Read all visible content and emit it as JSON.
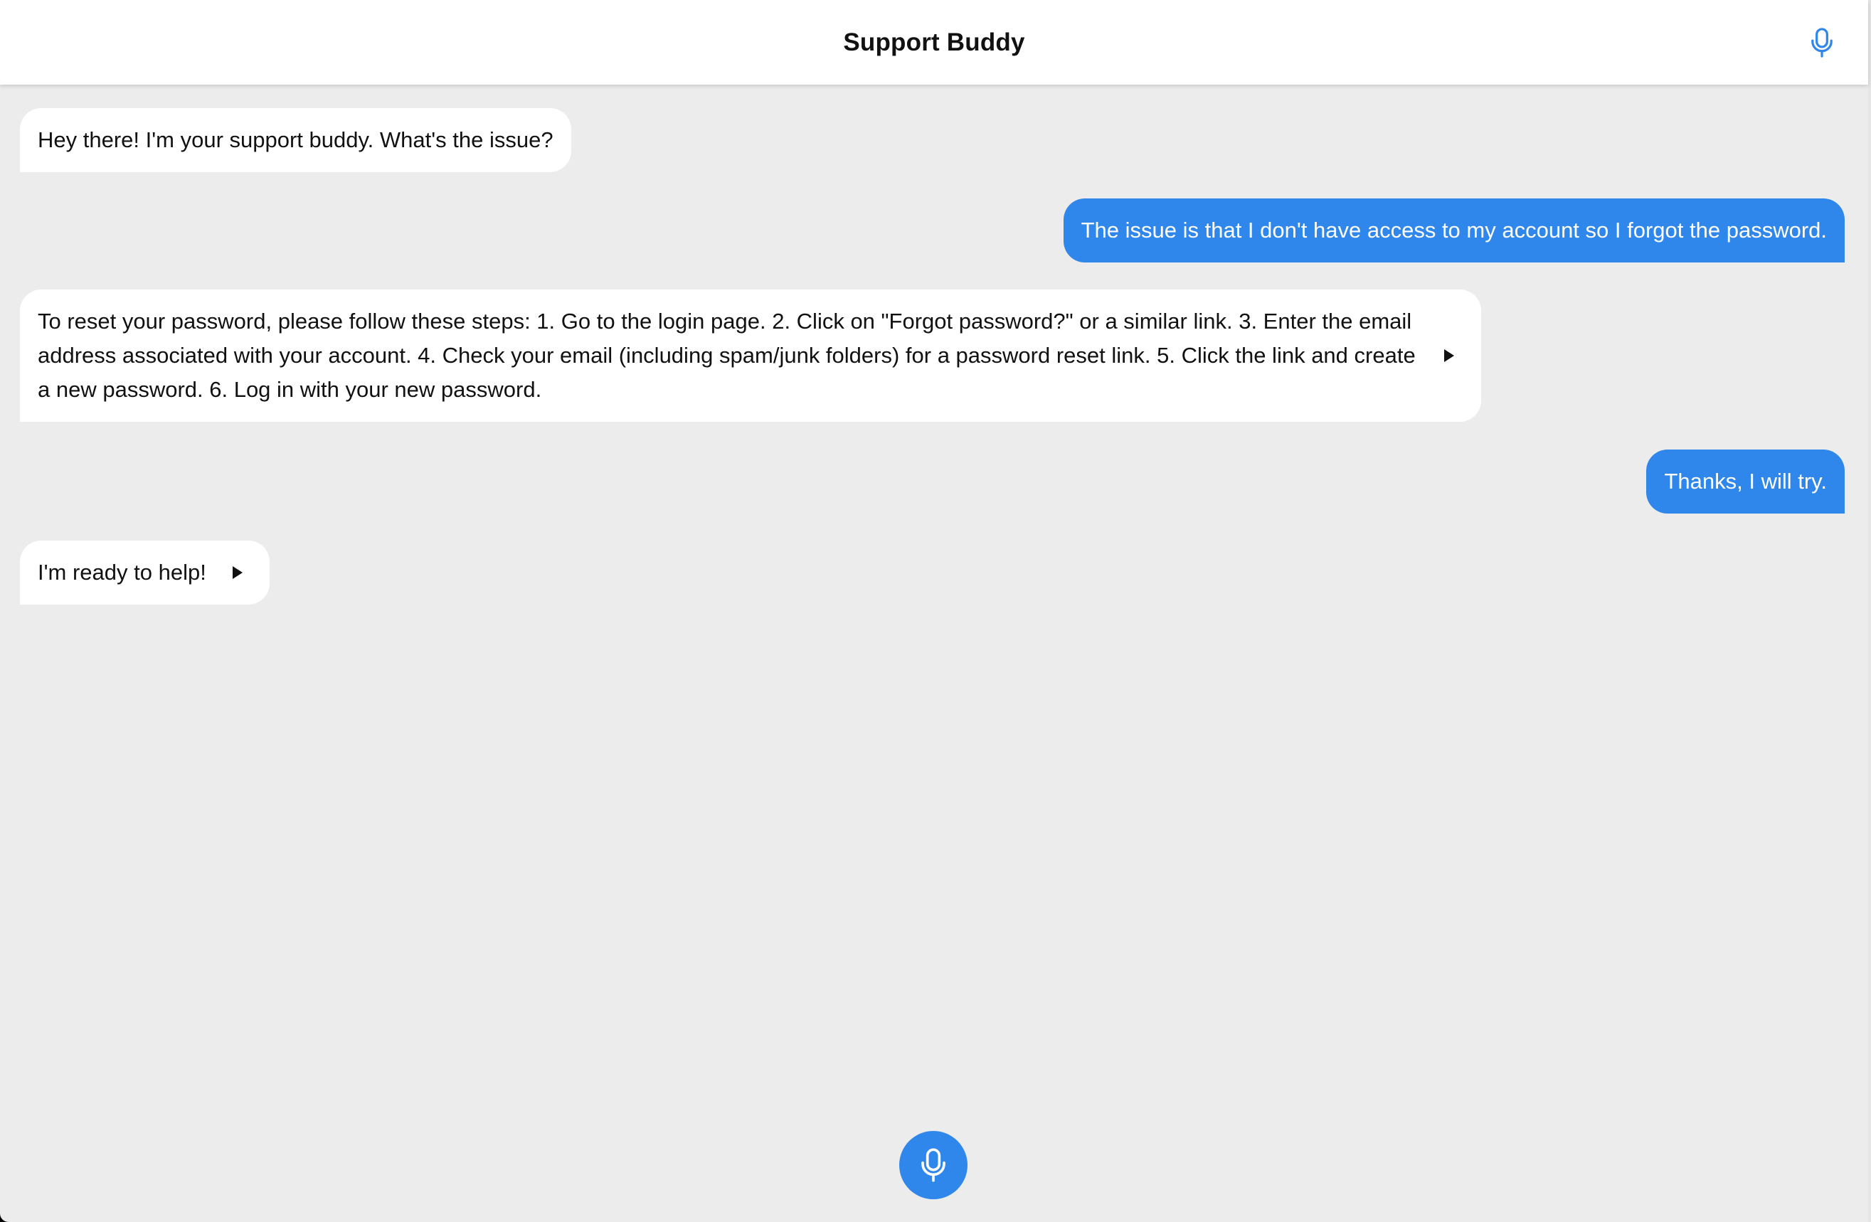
{
  "header": {
    "title": "Support Buddy",
    "mic_icon": "microphone-icon"
  },
  "colors": {
    "accent": "#2f86eb",
    "background": "#ececec",
    "bot_bubble": "#ffffff",
    "user_text": "#ffffff"
  },
  "messages": [
    {
      "sender": "bot",
      "text": "Hey there! I'm your support buddy. What's the issue?"
    },
    {
      "sender": "user",
      "text": "The issue is that I don't have access to my account so I forgot the password."
    },
    {
      "sender": "bot",
      "text": "To reset your password, please follow these steps: 1. Go to the login page. 2. Click on \"Forgot password?\" or a similar link. 3. Enter the email address associated with your account. 4. Check your email (including spam/junk folders) for a password reset link. 5. Click the link and create a new password. 6. Log in with your new password.",
      "play_icon": "play-icon"
    },
    {
      "sender": "user",
      "text": "Thanks, I will try."
    },
    {
      "sender": "bot",
      "text": "I'm ready to help!",
      "play_icon": "play-icon"
    }
  ],
  "footer": {
    "mic_icon": "microphone-icon"
  }
}
